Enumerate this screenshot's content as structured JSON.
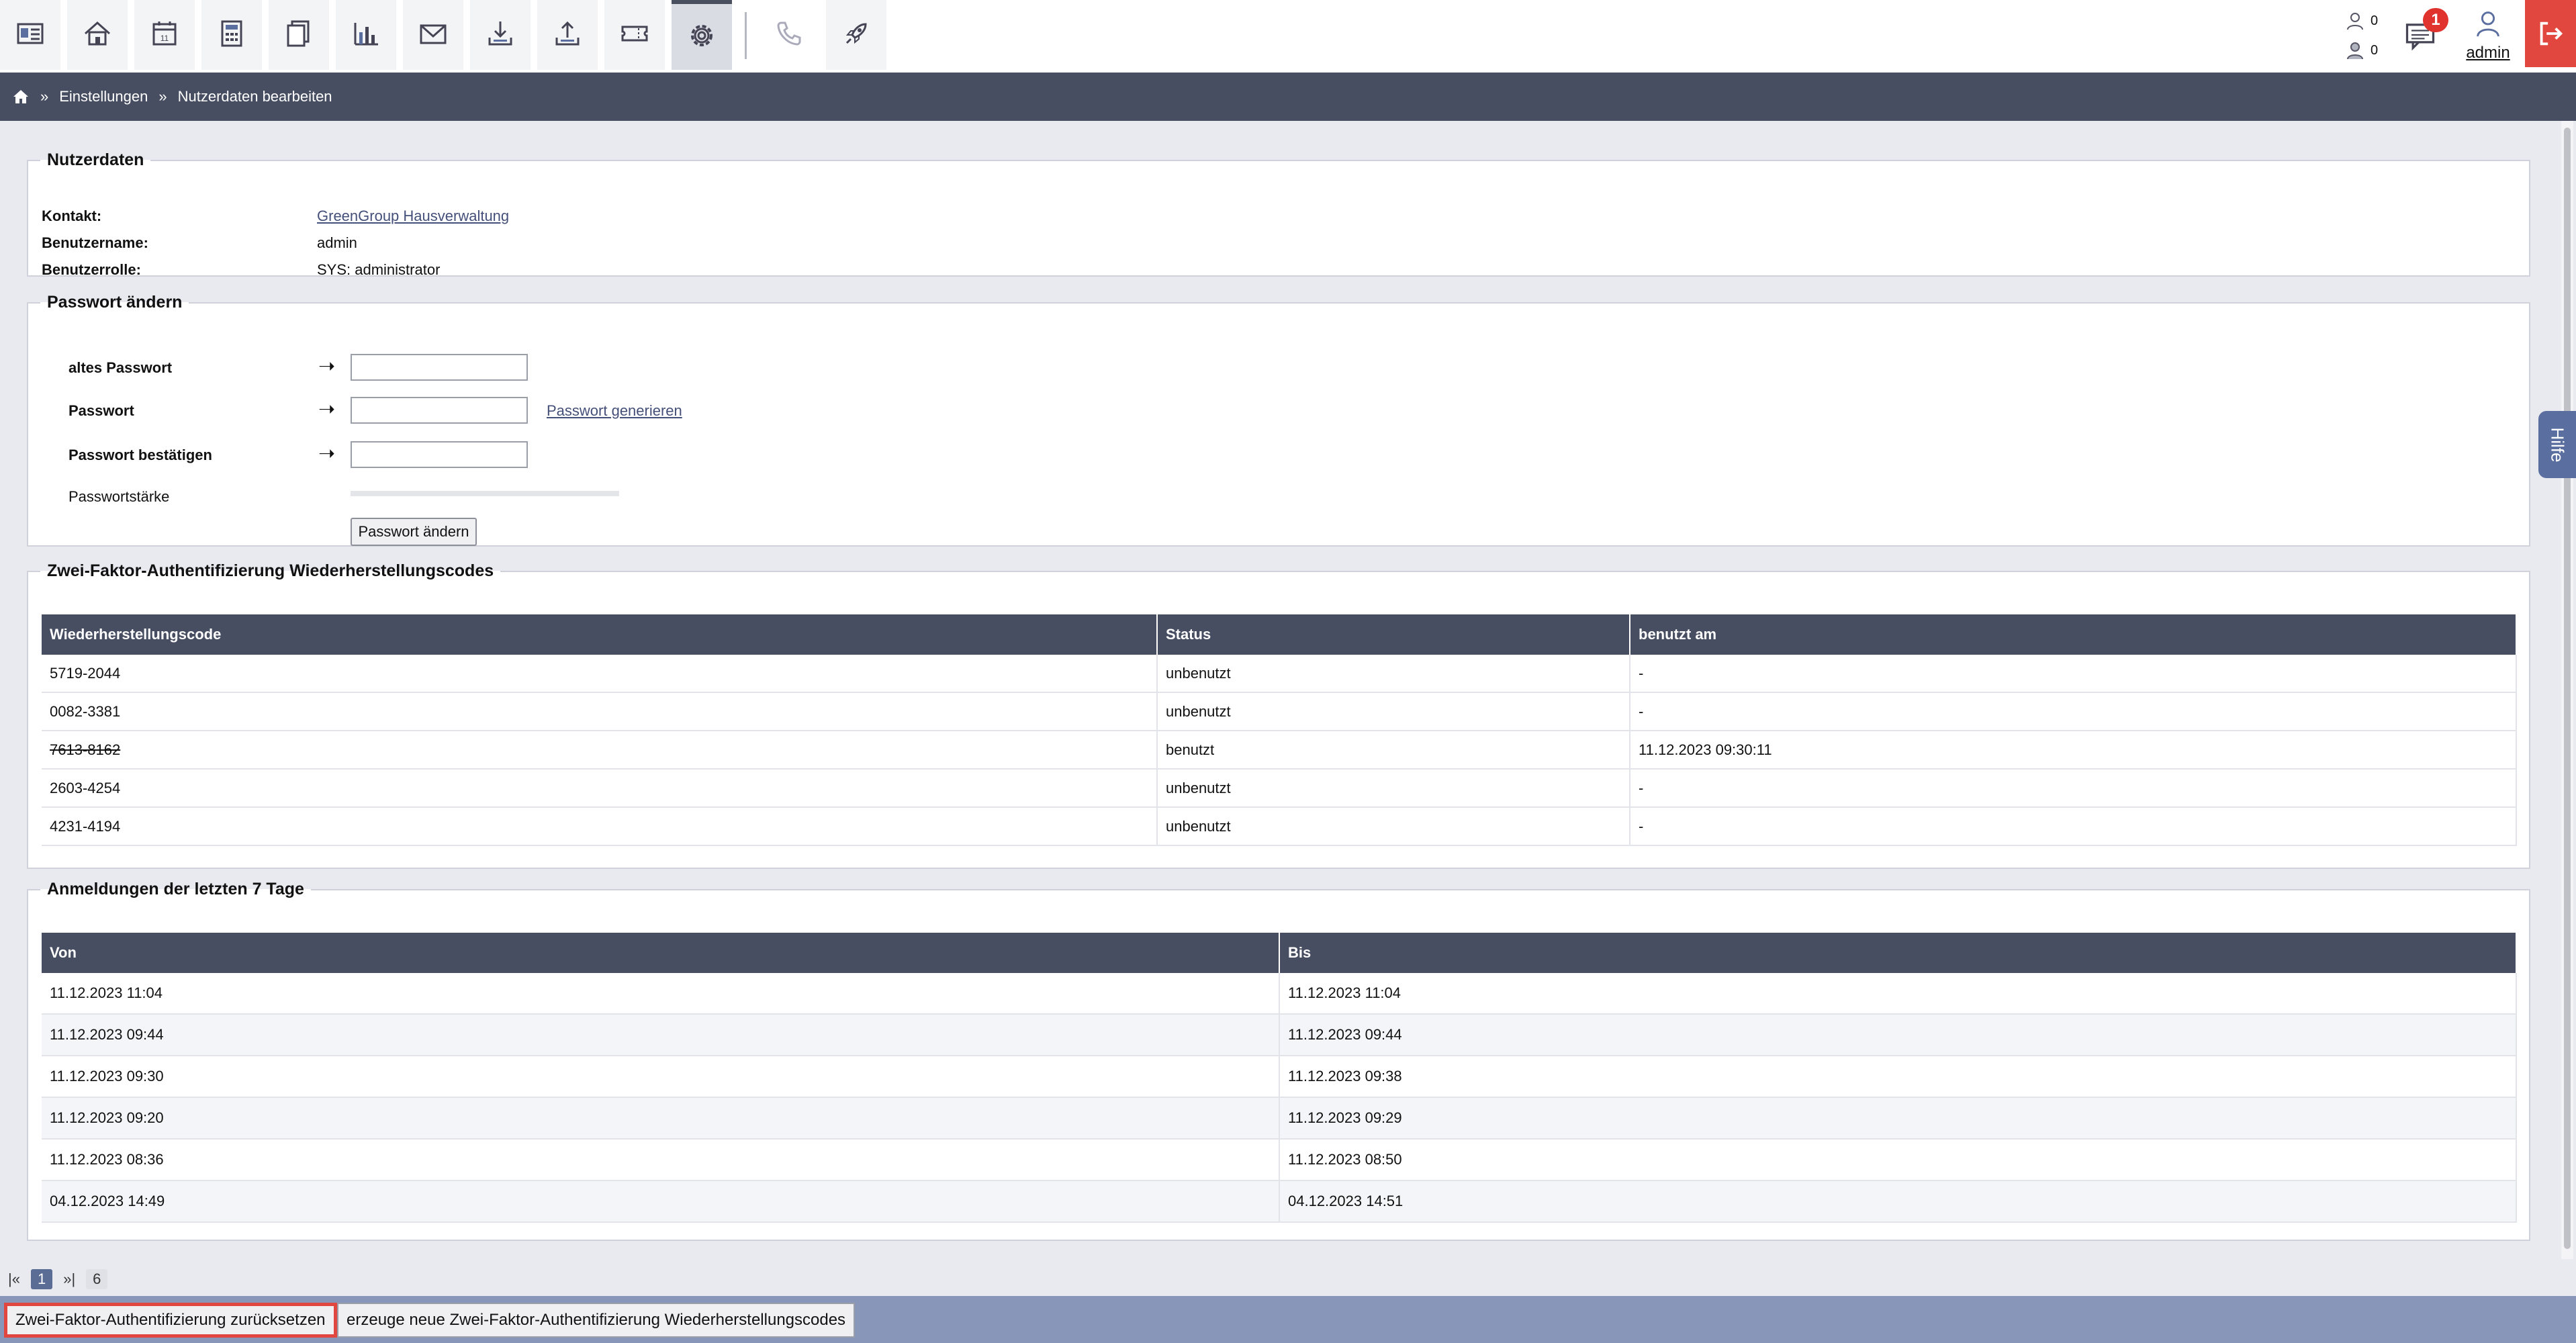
{
  "toolbar": {
    "icons": [
      "contacts-icon",
      "house-icon",
      "calendar-icon",
      "calculator-icon",
      "documents-icon",
      "chart-icon",
      "mail-icon",
      "download-icon",
      "upload-icon",
      "ticket-icon",
      "settings-icon",
      "phone-icon",
      "rocket-icon"
    ],
    "calendar_day": "11",
    "counter_1": "0",
    "counter_2": "0",
    "messages_badge": "1",
    "user_name": "admin"
  },
  "breadcrumb": {
    "sep": "»",
    "items": [
      "Einstellungen",
      "Nutzerdaten bearbeiten"
    ]
  },
  "help_tab": "Hilfe",
  "nutzerdaten": {
    "legend": "Nutzerdaten",
    "kontakt_label": "Kontakt:",
    "kontakt_value": "GreenGroup Hausverwaltung",
    "benutzername_label": "Benutzername:",
    "benutzername_value": "admin",
    "benutzerrolle_label": "Benutzerrolle:",
    "benutzerrolle_value": "SYS: administrator"
  },
  "passwort": {
    "legend": "Passwort ändern",
    "arrow": "➝",
    "altes_label": "altes Passwort",
    "neu_label": "Passwort",
    "generate_link": "Passwort generieren",
    "confirm_label": "Passwort bestätigen",
    "strength_label": "Passwortstärke",
    "submit_label": "Passwort ändern"
  },
  "codes": {
    "legend": "Zwei-Faktor-Authentifizierung Wiederherstellungscodes",
    "headers": [
      "Wiederherstellungscode",
      "Status",
      "benutzt am"
    ],
    "rows": [
      {
        "code": "5719-2044",
        "status": "unbenutzt",
        "used": "-"
      },
      {
        "code": "0082-3381",
        "status": "unbenutzt",
        "used": "-"
      },
      {
        "code": "7613-8162",
        "status": "benutzt",
        "used": "11.12.2023 09:30:11"
      },
      {
        "code": "2603-4254",
        "status": "unbenutzt",
        "used": "-"
      },
      {
        "code": "4231-4194",
        "status": "unbenutzt",
        "used": "-"
      }
    ]
  },
  "logins": {
    "legend": "Anmeldungen der letzten 7 Tage",
    "headers": [
      "Von",
      "Bis"
    ],
    "rows": [
      {
        "von": "11.12.2023 11:04",
        "bis": "11.12.2023 11:04"
      },
      {
        "von": "11.12.2023 09:44",
        "bis": "11.12.2023 09:44"
      },
      {
        "von": "11.12.2023 09:30",
        "bis": "11.12.2023 09:38"
      },
      {
        "von": "11.12.2023 09:20",
        "bis": "11.12.2023 09:29"
      },
      {
        "von": "11.12.2023 08:36",
        "bis": "11.12.2023 08:50"
      },
      {
        "von": "04.12.2023 14:49",
        "bis": "04.12.2023 14:51"
      }
    ]
  },
  "pagination": {
    "first": "|«",
    "current": "1",
    "last": "»|",
    "total": "6"
  },
  "bottom": {
    "reset_label": "Zwei-Faktor-Authentifizierung zurücksetzen",
    "generate_label": "erzeuge neue Zwei-Faktor-Authentifizierung Wiederherstellungscodes"
  },
  "colors": {
    "header_dark": "#474e61",
    "bottom_bar": "#8896b9",
    "logout": "#e2473f",
    "link": "#45507a"
  }
}
